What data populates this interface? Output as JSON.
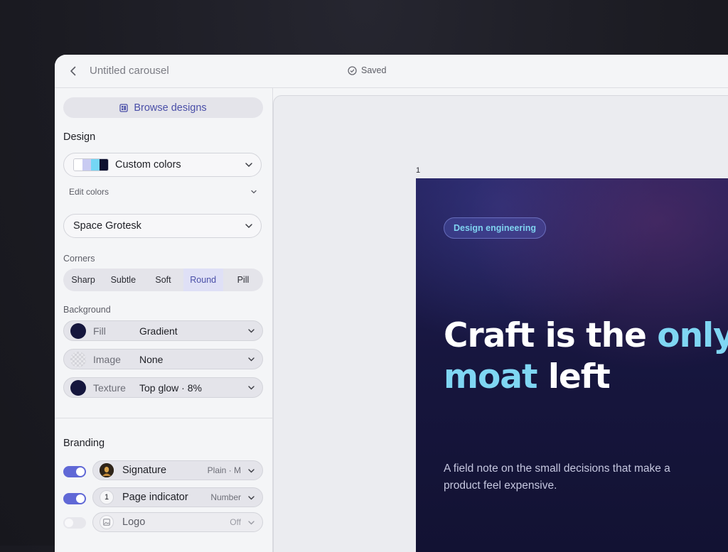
{
  "header": {
    "title": "Untitled carousel",
    "status": "Saved"
  },
  "sidebar": {
    "browse_label": "Browse designs",
    "design": {
      "section_title": "Design",
      "palette": {
        "label": "Custom colors",
        "swatch_colors": [
          "#ffffff",
          "#c9cbf2",
          "#74d6f5",
          "#0f1230"
        ]
      },
      "edit_colors_label": "Edit colors",
      "font": "Space Grotesk",
      "corners_label": "Corners",
      "corners": [
        "Sharp",
        "Subtle",
        "Soft",
        "Round",
        "Pill"
      ],
      "corners_selected": "Round"
    },
    "background": {
      "section_title": "Background",
      "rows": [
        {
          "label": "Fill",
          "value": "Gradient",
          "swatch": "#15163d"
        },
        {
          "label": "Image",
          "value": "None",
          "swatch": "checker"
        },
        {
          "label": "Texture",
          "value": "Top glow · 8%",
          "swatch": "#15163d"
        }
      ]
    },
    "branding": {
      "section_title": "Branding",
      "items": [
        {
          "name": "Signature",
          "meta": "Plain · M",
          "enabled": true,
          "icon": "avatar-icon"
        },
        {
          "name": "Page indicator",
          "meta": "Number",
          "enabled": true,
          "icon_text": "1"
        },
        {
          "name": "Logo",
          "meta": "Off",
          "enabled": false,
          "icon": "image-icon"
        }
      ]
    }
  },
  "canvas": {
    "page_number": "1",
    "slide": {
      "tag": "Design engineering",
      "headline_part1": "Craft is the ",
      "headline_highlight1": "only",
      "headline_highlight2": "moat",
      "headline_part2": " left",
      "subtext": "A field note on the small decisions that make a product feel expensive."
    }
  },
  "colors": {
    "accent": "#4a4fa8",
    "toggle_on": "#6068d6",
    "headline_highlight": "#7fd6f3",
    "slide_bg": "#17163f"
  }
}
